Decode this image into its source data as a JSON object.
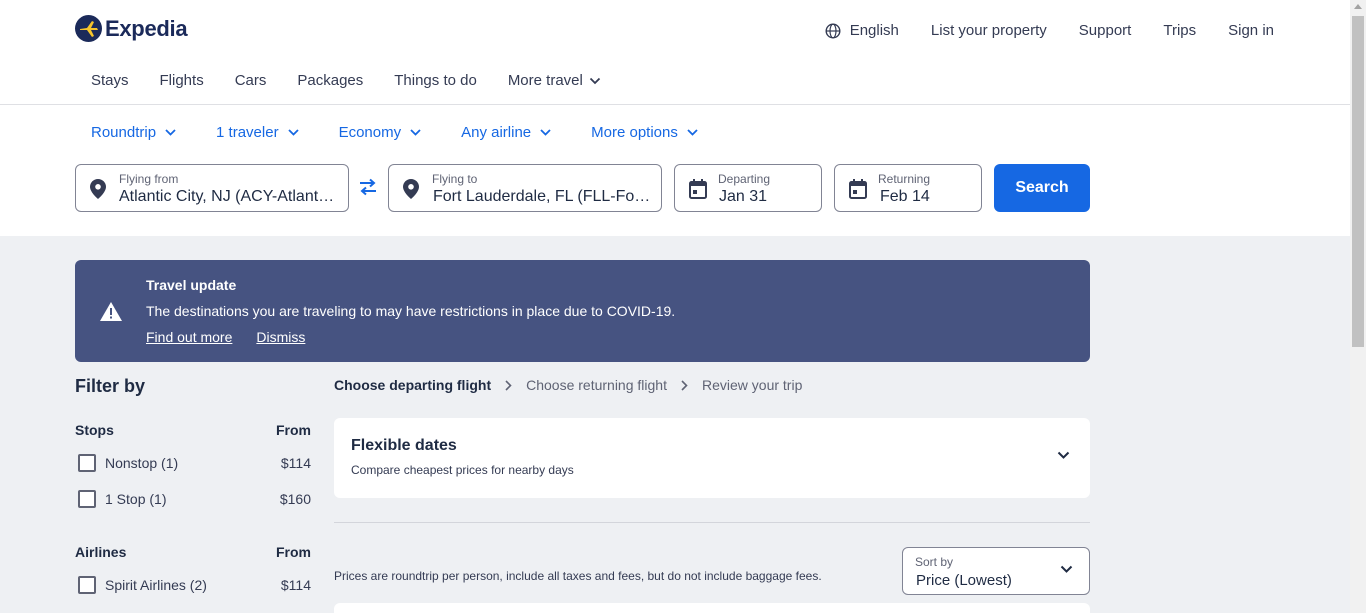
{
  "brand": {
    "name": "Expedia",
    "color": "#1b2a5a"
  },
  "topnav": {
    "language": "English",
    "list_property": "List your property",
    "support": "Support",
    "trips": "Trips",
    "sign_in": "Sign in"
  },
  "tabs": [
    "Stays",
    "Flights",
    "Cars",
    "Packages",
    "Things to do",
    "More travel"
  ],
  "search_options": {
    "trip_type": "Roundtrip",
    "travelers": "1 traveler",
    "cabin": "Economy",
    "airline": "Any airline",
    "more": "More options"
  },
  "search_form": {
    "from_label": "Flying from",
    "from_value": "Atlantic City, NJ (ACY-Atlantic City Intl.)",
    "to_label": "Flying to",
    "to_value": "Fort Lauderdale, FL (FLL-Fort Lauderdale-Hollywood Intl.)",
    "depart_label": "Departing",
    "depart_value": "Jan 31",
    "return_label": "Returning",
    "return_value": "Feb 14",
    "search_button": "Search"
  },
  "travel_update": {
    "title": "Travel update",
    "text": "The destinations you are traveling to may have restrictions in place due to COVID-19.",
    "find_out_more": "Find out more",
    "dismiss": "Dismiss"
  },
  "filters": {
    "title": "Filter by",
    "stops": {
      "heading": "Stops",
      "from": "From",
      "items": [
        {
          "label": "Nonstop (1)",
          "price": "$114"
        },
        {
          "label": "1 Stop (1)",
          "price": "$160"
        }
      ]
    },
    "airlines": {
      "heading": "Airlines",
      "from": "From",
      "items": [
        {
          "label": "Spirit Airlines (2)",
          "price": "$114"
        }
      ]
    }
  },
  "steps": [
    "Choose departing flight",
    "Choose returning flight",
    "Review your trip"
  ],
  "flexible_dates": {
    "title": "Flexible dates",
    "subtitle": "Compare cheapest prices for nearby days"
  },
  "price_note": "Prices are roundtrip per person, include all taxes and fees, but do not include baggage fees.",
  "sort": {
    "label": "Sort by",
    "value": "Price (Lowest)"
  },
  "colors": {
    "accent": "#1668e3",
    "banner": "#465381",
    "background": "#eef0f3"
  }
}
